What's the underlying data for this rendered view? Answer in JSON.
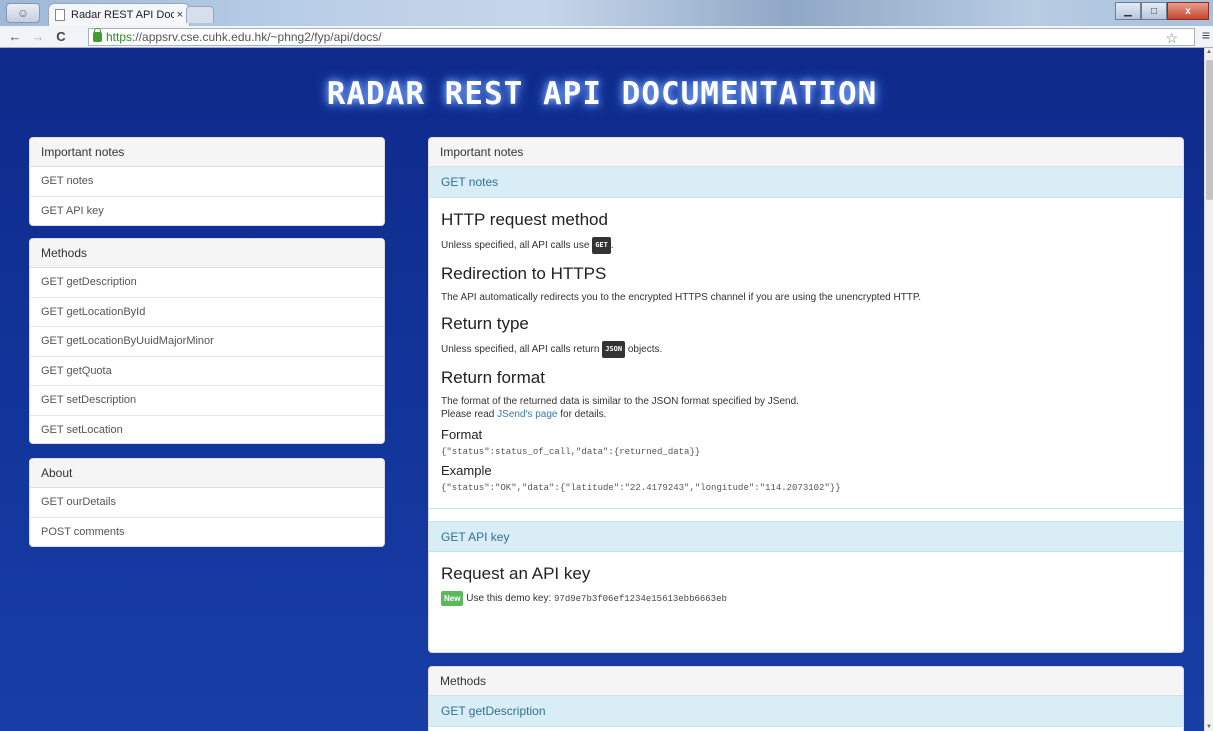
{
  "browser": {
    "tab_title": "Radar REST API Document",
    "tab_close": "×",
    "url_https": "https",
    "url_rest": "://appsrv.cse.cuhk.edu.hk/~phng2/fyp/api/docs/",
    "back": "←",
    "forward": "→",
    "reload": "C",
    "star": "☆",
    "menu": "≡",
    "minimize": "▁",
    "maximize": "□",
    "close": "x"
  },
  "page": {
    "title": "RADAR REST API DOCUMENTATION"
  },
  "sidebar": {
    "notes": {
      "heading": "Important notes",
      "items": [
        "GET notes",
        "GET API key"
      ]
    },
    "methods": {
      "heading": "Methods",
      "items": [
        "GET getDescription",
        "GET getLocationById",
        "GET getLocationByUuidMajorMinor",
        "GET getQuota",
        "GET setDescription",
        "GET setLocation"
      ]
    },
    "about": {
      "heading": "About",
      "items": [
        "GET ourDetails",
        "POST comments"
      ]
    }
  },
  "main": {
    "notes": {
      "heading": "Important notes",
      "get_notes": {
        "heading": "GET notes",
        "http_title": "HTTP request method",
        "http_text_pre": "Unless specified, all API calls use ",
        "http_badge": "GET",
        "http_text_post": ".",
        "redirect_title": "Redirection to HTTPS",
        "redirect_text": "The API automatically redirects you to the encrypted HTTPS channel if you are using the unencrypted HTTP.",
        "return_type_title": "Return type",
        "return_type_pre": "Unless specified, all API calls return ",
        "return_type_badge": "JSON",
        "return_type_post": " objects.",
        "return_format_title": "Return format",
        "return_format_line1": "The format of the returned data is similar to the JSON format specified by JSend.",
        "return_format_line2_pre": "Please read ",
        "return_format_link": "JSend's page",
        "return_format_line2_post": " for details.",
        "format_title": "Format",
        "format_code": "{\"status\":status_of_call,\"data\":{returned_data}}",
        "example_title": "Example",
        "example_code": "{\"status\":\"OK\",\"data\":{\"latitude\":\"22.4179243\",\"longitude\":\"114.2073102\"}}"
      },
      "get_api_key": {
        "heading": "GET API key",
        "title": "Request an API key",
        "badge": "New",
        "text": " Use this demo key: ",
        "key": "97d9e7b3f06ef1234e15613ebb6663eb"
      }
    },
    "methods": {
      "heading": "Methods",
      "first_item": "GET getDescription"
    }
  }
}
